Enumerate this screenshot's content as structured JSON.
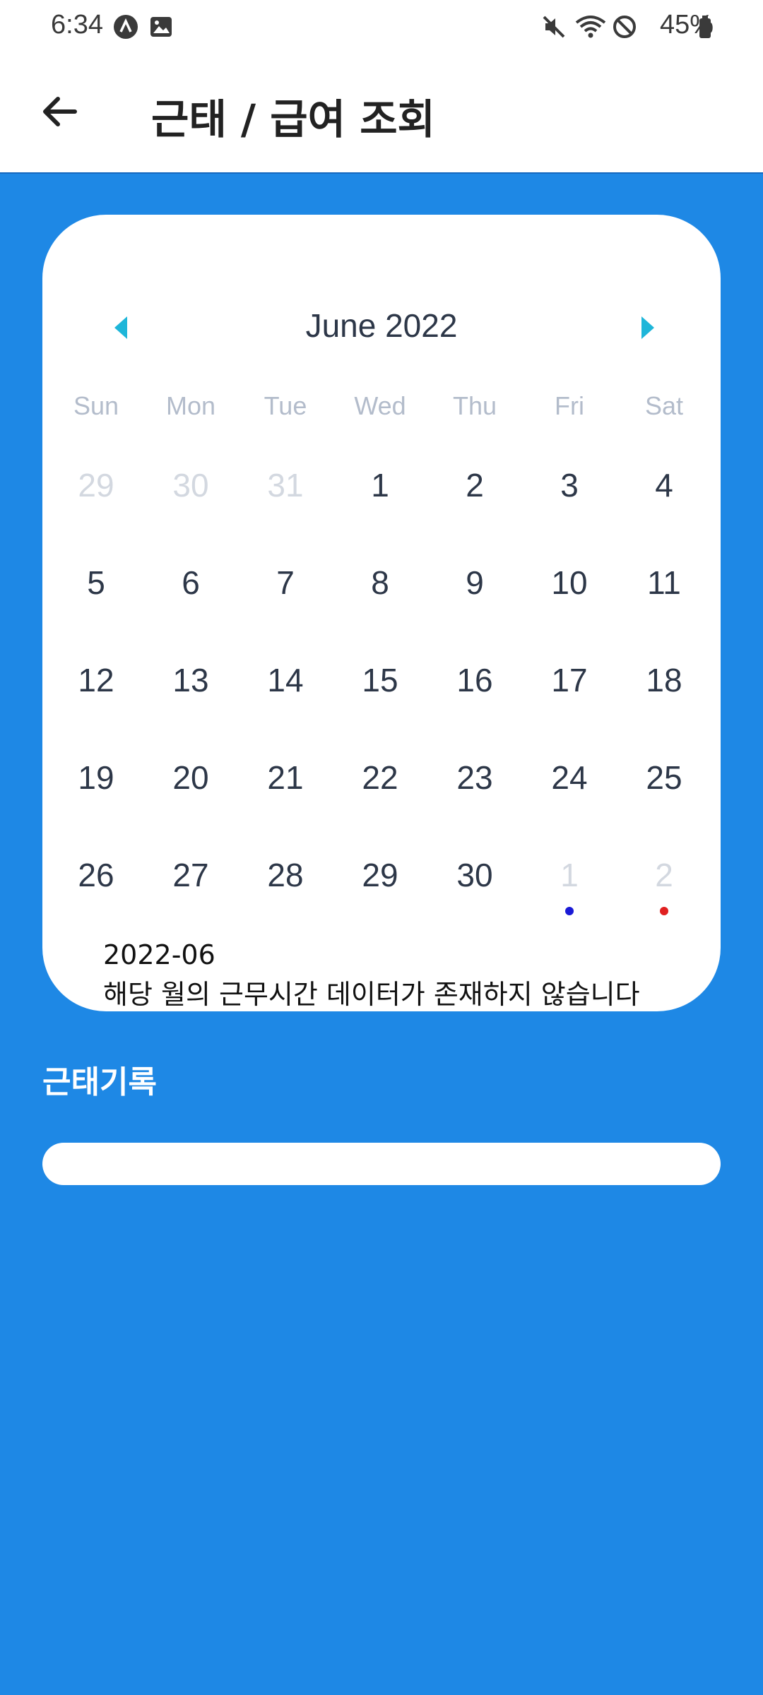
{
  "status_bar": {
    "time": "6:34",
    "battery": "45%",
    "icons": [
      "app-notification-icon",
      "image-icon",
      "mute-icon",
      "wifi-icon",
      "do-not-disturb-icon",
      "battery-icon"
    ]
  },
  "app_bar": {
    "title": "근태 / 급여 조회",
    "back_icon": "arrow-left-icon"
  },
  "calendar": {
    "month_label": "June 2022",
    "prev_icon": "triangle-left-icon",
    "next_icon": "triangle-right-icon",
    "accent_color": "#1EB6D9",
    "weekdays": [
      "Sun",
      "Mon",
      "Tue",
      "Wed",
      "Thu",
      "Fri",
      "Sat"
    ],
    "weeks": [
      [
        {
          "d": "29",
          "other": true
        },
        {
          "d": "30",
          "other": true
        },
        {
          "d": "31",
          "other": true
        },
        {
          "d": "1"
        },
        {
          "d": "2"
        },
        {
          "d": "3"
        },
        {
          "d": "4"
        }
      ],
      [
        {
          "d": "5"
        },
        {
          "d": "6"
        },
        {
          "d": "7"
        },
        {
          "d": "8"
        },
        {
          "d": "9"
        },
        {
          "d": "10"
        },
        {
          "d": "11"
        }
      ],
      [
        {
          "d": "12"
        },
        {
          "d": "13"
        },
        {
          "d": "14"
        },
        {
          "d": "15"
        },
        {
          "d": "16"
        },
        {
          "d": "17"
        },
        {
          "d": "18"
        }
      ],
      [
        {
          "d": "19"
        },
        {
          "d": "20"
        },
        {
          "d": "21"
        },
        {
          "d": "22"
        },
        {
          "d": "23"
        },
        {
          "d": "24"
        },
        {
          "d": "25"
        }
      ],
      [
        {
          "d": "26"
        },
        {
          "d": "27"
        },
        {
          "d": "28"
        },
        {
          "d": "29"
        },
        {
          "d": "30"
        },
        {
          "d": "1",
          "other": true,
          "dot": "#1a1ad6"
        },
        {
          "d": "2",
          "other": true,
          "dot": "#e02020"
        }
      ]
    ]
  },
  "summary": {
    "month": "2022-06",
    "message": "해당 월의 근무시간 데이터가 존재하지 않습니다"
  },
  "records": {
    "title": "근태기록"
  },
  "colors": {
    "background": "#1E88E5",
    "text_dark": "#2d3748",
    "weekday": "#b3bccb",
    "other_month": "#d3d8e0"
  }
}
